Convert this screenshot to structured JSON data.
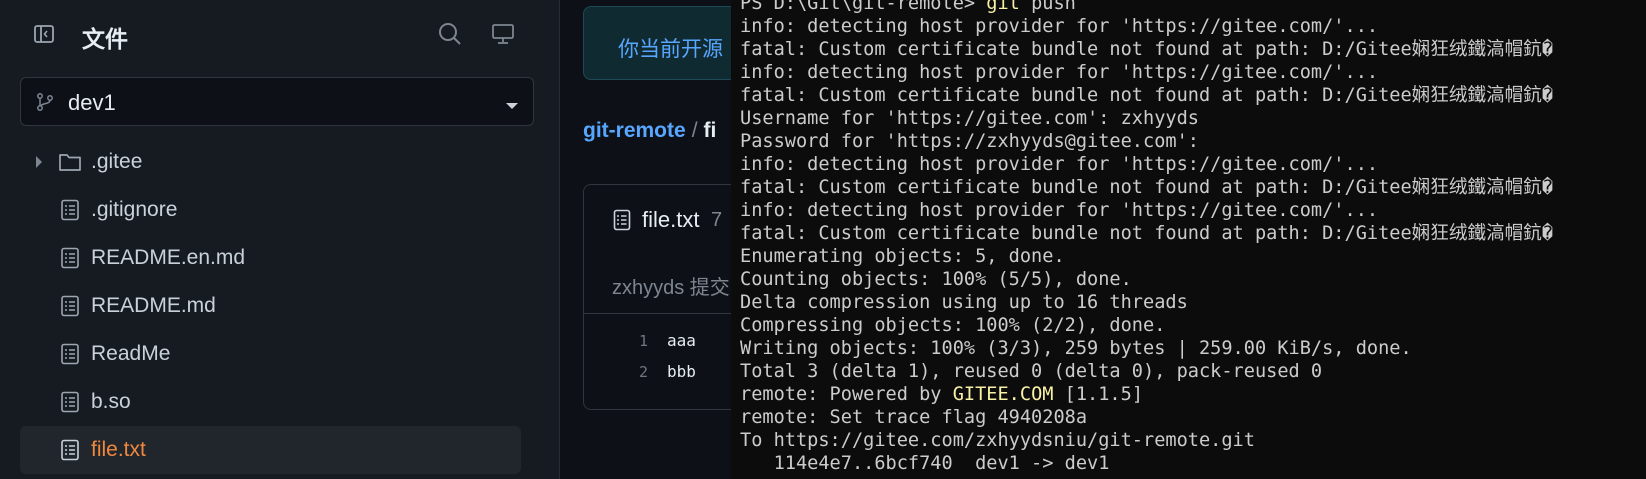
{
  "sidebar": {
    "title": "文件",
    "branch": "dev1",
    "items": [
      {
        "label": ".gitee",
        "type": "folder"
      },
      {
        "label": ".gitignore",
        "type": "file"
      },
      {
        "label": "README.en.md",
        "type": "file"
      },
      {
        "label": "README.md",
        "type": "file"
      },
      {
        "label": "ReadMe",
        "type": "file"
      },
      {
        "label": "b.so",
        "type": "file"
      },
      {
        "label": "file.txt",
        "type": "file",
        "active": true
      }
    ],
    "icons": {
      "toggle": "sidebar-toggle-icon",
      "search": "search-icon",
      "monitor": "monitor-icon",
      "branch": "git-branch-icon",
      "caret": "caret-down-icon",
      "folder": "folder-icon",
      "file": "file-text-icon",
      "chevron": "chevron-right-icon"
    }
  },
  "content": {
    "notice": "你当前开源",
    "breadcrumb": {
      "repo": "git-remote",
      "sep": "/",
      "file": "fi"
    },
    "file": {
      "name": "file.txt",
      "size": "7",
      "commit_author": "zxhyyds 提交",
      "lines": [
        {
          "num": "1",
          "text": "aaa"
        },
        {
          "num": "2",
          "text": "bbb"
        }
      ]
    }
  },
  "terminal": {
    "lines": [
      {
        "pre": "PS D:\\Git\\git-remote> ",
        "hl": "git",
        "post": " push"
      },
      {
        "pre": "info: detecting host provider for 'https://gitee.com/'..."
      },
      {
        "pre": "fatal: Custom certificate bundle not found at path: D:/Gitee娴狂绒鐵滈帽鈧�"
      },
      {
        "pre": "info: detecting host provider for 'https://gitee.com/'..."
      },
      {
        "pre": "fatal: Custom certificate bundle not found at path: D:/Gitee娴狂绒鐵滈帽鈧�"
      },
      {
        "pre": "Username for 'https://gitee.com': zxhyyds"
      },
      {
        "pre": "Password for 'https://zxhyyds@gitee.com':"
      },
      {
        "pre": "info: detecting host provider for 'https://gitee.com/'..."
      },
      {
        "pre": "fatal: Custom certificate bundle not found at path: D:/Gitee娴狂绒鐵滈帽鈧�"
      },
      {
        "pre": "info: detecting host provider for 'https://gitee.com/'..."
      },
      {
        "pre": "fatal: Custom certificate bundle not found at path: D:/Gitee娴狂绒鐵滈帽鈧�"
      },
      {
        "pre": "Enumerating objects: 5, done."
      },
      {
        "pre": "Counting objects: 100% (5/5), done."
      },
      {
        "pre": "Delta compression using up to 16 threads"
      },
      {
        "pre": "Compressing objects: 100% (2/2), done."
      },
      {
        "pre": "Writing objects: 100% (3/3), 259 bytes | 259.00 KiB/s, done."
      },
      {
        "pre": "Total 3 (delta 1), reused 0 (delta 0), pack-reused 0"
      },
      {
        "pre": "remote: Powered by ",
        "hl": "GITEE.COM",
        "post": " [1.1.5]"
      },
      {
        "pre": "remote: Set trace flag 4940208a"
      },
      {
        "pre": "To https://gitee.com/zxhyydsniu/git-remote.git"
      },
      {
        "pre": "   114e4e7..6bcf740  dev1 -> dev1"
      }
    ]
  }
}
